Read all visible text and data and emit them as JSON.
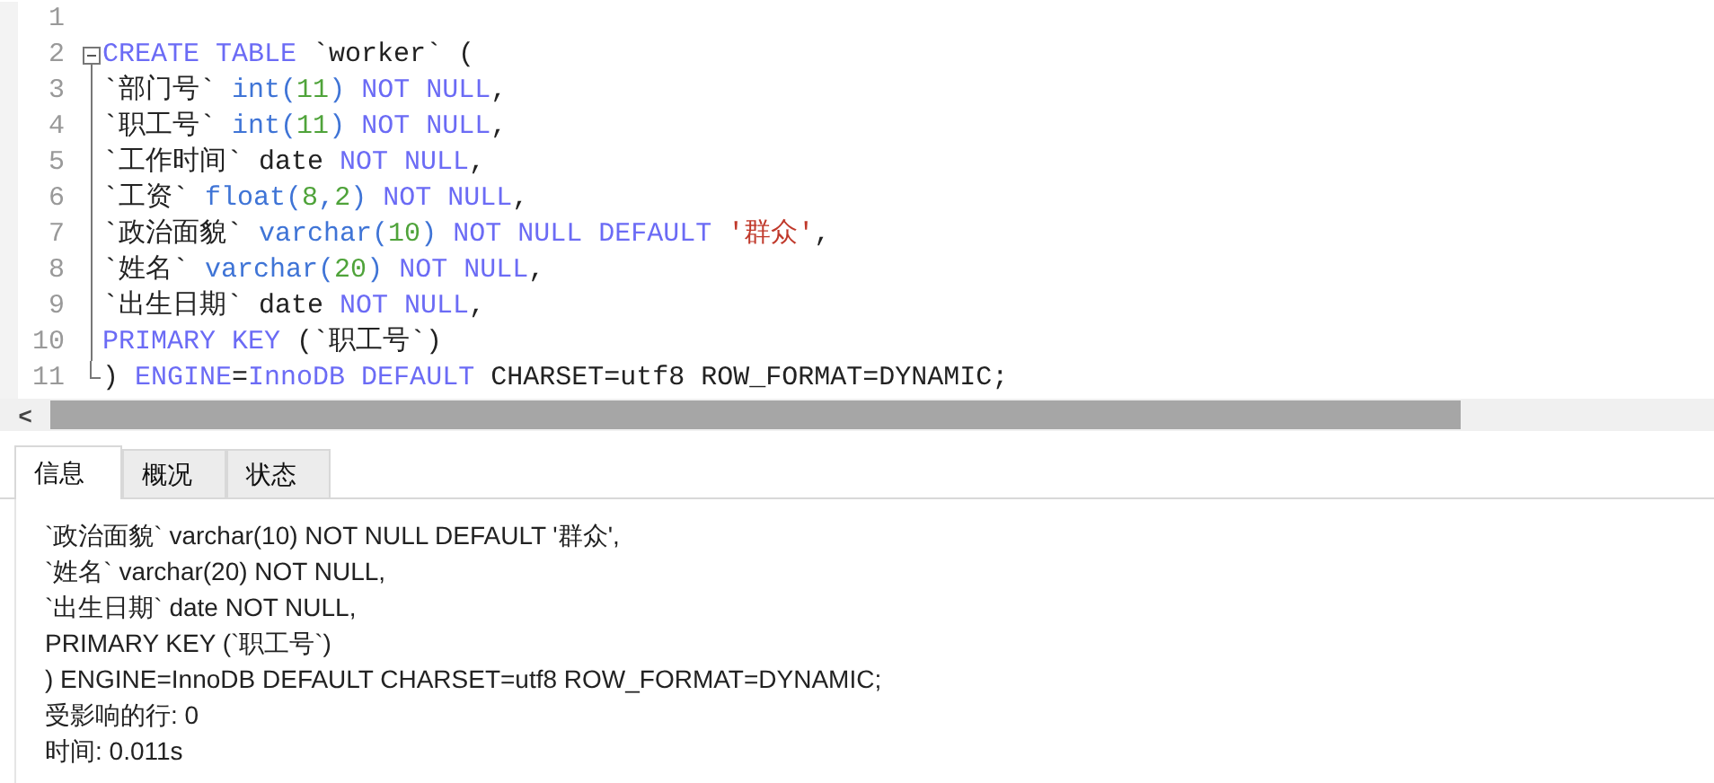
{
  "editor": {
    "lines": [
      {
        "number": "1",
        "kind": "none"
      },
      {
        "number": "2",
        "kind": "start",
        "tokens": [
          {
            "t": "CREATE TABLE",
            "kind": "keyword"
          },
          {
            "t": " `worker` (",
            "kind": "plain"
          }
        ]
      },
      {
        "number": "3",
        "kind": "mid",
        "tokens": [
          {
            "t": "`部门号` ",
            "kind": "plain"
          },
          {
            "t": "int",
            "kind": "type"
          },
          {
            "t": "(",
            "kind": "type"
          },
          {
            "t": "11",
            "kind": "number"
          },
          {
            "t": ") ",
            "kind": "type"
          },
          {
            "t": "NOT NULL",
            "kind": "keyword"
          },
          {
            "t": ",",
            "kind": "plain"
          }
        ]
      },
      {
        "number": "4",
        "kind": "mid",
        "tokens": [
          {
            "t": "`职工号` ",
            "kind": "plain"
          },
          {
            "t": "int",
            "kind": "type"
          },
          {
            "t": "(",
            "kind": "type"
          },
          {
            "t": "11",
            "kind": "number"
          },
          {
            "t": ") ",
            "kind": "type"
          },
          {
            "t": "NOT NULL",
            "kind": "keyword"
          },
          {
            "t": ",",
            "kind": "plain"
          }
        ]
      },
      {
        "number": "5",
        "kind": "mid",
        "tokens": [
          {
            "t": "`工作时间` date ",
            "kind": "plain"
          },
          {
            "t": "NOT NULL",
            "kind": "keyword"
          },
          {
            "t": ",",
            "kind": "plain"
          }
        ]
      },
      {
        "number": "6",
        "kind": "mid",
        "tokens": [
          {
            "t": "`工资` ",
            "kind": "plain"
          },
          {
            "t": "float",
            "kind": "type"
          },
          {
            "t": "(",
            "kind": "type"
          },
          {
            "t": "8",
            "kind": "number"
          },
          {
            "t": ",",
            "kind": "type"
          },
          {
            "t": "2",
            "kind": "number"
          },
          {
            "t": ") ",
            "kind": "type"
          },
          {
            "t": "NOT NULL",
            "kind": "keyword"
          },
          {
            "t": ",",
            "kind": "plain"
          }
        ]
      },
      {
        "number": "7",
        "kind": "mid",
        "tokens": [
          {
            "t": "`政治面貌` ",
            "kind": "plain"
          },
          {
            "t": "varchar",
            "kind": "type"
          },
          {
            "t": "(",
            "kind": "type"
          },
          {
            "t": "10",
            "kind": "number"
          },
          {
            "t": ") ",
            "kind": "type"
          },
          {
            "t": "NOT NULL DEFAULT ",
            "kind": "keyword"
          },
          {
            "t": "'群众'",
            "kind": "string"
          },
          {
            "t": ",",
            "kind": "plain"
          }
        ]
      },
      {
        "number": "8",
        "kind": "mid",
        "tokens": [
          {
            "t": "`姓名` ",
            "kind": "plain"
          },
          {
            "t": "varchar",
            "kind": "type"
          },
          {
            "t": "(",
            "kind": "type"
          },
          {
            "t": "20",
            "kind": "number"
          },
          {
            "t": ") ",
            "kind": "type"
          },
          {
            "t": "NOT NULL",
            "kind": "keyword"
          },
          {
            "t": ",",
            "kind": "plain"
          }
        ]
      },
      {
        "number": "9",
        "kind": "mid",
        "tokens": [
          {
            "t": "`出生日期` date ",
            "kind": "plain"
          },
          {
            "t": "NOT NULL",
            "kind": "keyword"
          },
          {
            "t": ",",
            "kind": "plain"
          }
        ]
      },
      {
        "number": "10",
        "kind": "mid",
        "tokens": [
          {
            "t": "PRIMARY KEY",
            "kind": "keyword"
          },
          {
            "t": " (`职工号`)",
            "kind": "plain"
          }
        ]
      },
      {
        "number": "11",
        "kind": "end",
        "tokens": [
          {
            "t": ") ",
            "kind": "plain"
          },
          {
            "t": "ENGINE",
            "kind": "keyword"
          },
          {
            "t": "=",
            "kind": "plain"
          },
          {
            "t": "InnoDB DEFAULT",
            "kind": "keyword"
          },
          {
            "t": " CHARSET=utf8 ROW_FORMAT=DYNAMIC;",
            "kind": "plain"
          }
        ]
      }
    ],
    "scroll_left": "<"
  },
  "tabs": [
    {
      "label": "信息",
      "selected": true
    },
    {
      "label": "概况",
      "selected": false
    },
    {
      "label": "状态",
      "selected": false
    }
  ],
  "output": [
    "`政治面貌` varchar(10) NOT NULL DEFAULT '群众',",
    "`姓名` varchar(20) NOT NULL,",
    "`出生日期` date NOT NULL,",
    "PRIMARY KEY (`职工号`)",
    ") ENGINE=InnoDB DEFAULT CHARSET=utf8 ROW_FORMAT=DYNAMIC;",
    "受影响的行: 0",
    "时间: 0.011s"
  ]
}
